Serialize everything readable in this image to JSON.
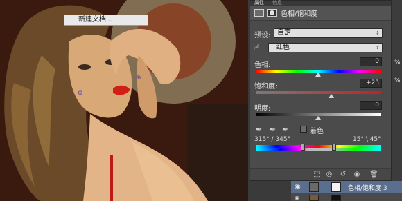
{
  "canvas": {
    "context_menu_item": "新建文档..."
  },
  "panel": {
    "tabs": [
      "属性",
      "信息"
    ],
    "title": "色相/饱和度",
    "preset_label": "预设:",
    "preset_value": "自定",
    "channel_value": "红色",
    "hue_label": "色相:",
    "hue_value": "0",
    "saturation_label": "饱和度:",
    "saturation_value": "+23",
    "lightness_label": "明度:",
    "lightness_value": "0",
    "colorize_label": "着色",
    "range_left": "315° / 345°",
    "range_right": "15° \\ 45°"
  },
  "rightbar": {
    "items": [
      "%",
      "%"
    ]
  },
  "layers": {
    "active_layer_name": "色相/饱和度 3"
  },
  "colors": {
    "panel_bg": "#4b4b4b",
    "dropdown_bg": "#e1e1e1",
    "layer_selected": "#5a6f8f"
  },
  "icons": {
    "hand": "hand-target-icon",
    "eyedropper": "eyedropper-icon",
    "eyedropper_plus": "eyedropper-plus-icon",
    "eyedropper_minus": "eyedropper-minus-icon",
    "eye": "eye-icon",
    "trash": "trash-icon"
  }
}
